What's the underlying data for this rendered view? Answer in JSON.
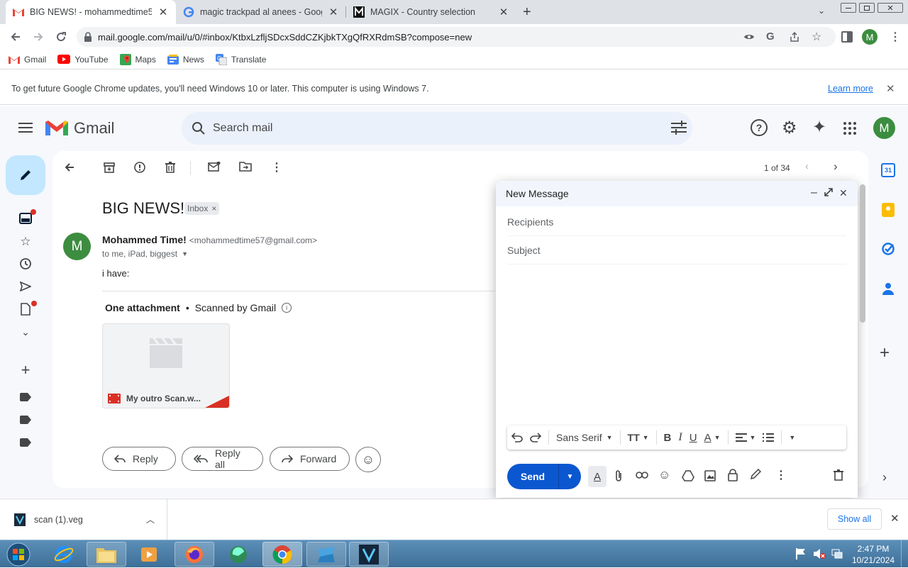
{
  "browser": {
    "tabs": [
      {
        "title": "BIG NEWS! - mohammedtime57@",
        "icon": "gmail-icon",
        "active": true
      },
      {
        "title": "magic trackpad al anees - Googl",
        "icon": "google-icon",
        "active": false
      },
      {
        "title": "MAGIX - Country selection",
        "icon": "magix-icon",
        "active": false
      }
    ],
    "url": "mail.google.com/mail/u/0/#inbox/KtbxLzfljSDcxSddCZKjbkTXgQfRXRdmSB?compose=new",
    "profile_initial": "M",
    "bookmarks": [
      {
        "label": "Gmail",
        "icon": "gmail-icon"
      },
      {
        "label": "YouTube",
        "icon": "youtube-icon"
      },
      {
        "label": "Maps",
        "icon": "maps-icon"
      },
      {
        "label": "News",
        "icon": "news-icon"
      },
      {
        "label": "Translate",
        "icon": "translate-icon"
      }
    ],
    "infobar": {
      "message": "To get future Google Chrome updates, you'll need Windows 10 or later. This computer is using Windows 7.",
      "link": "Learn more"
    }
  },
  "gmail": {
    "logo_text": "Gmail",
    "search_placeholder": "Search mail",
    "avatar_initial": "M",
    "pager": "1 of 34",
    "email": {
      "subject": "BIG NEWS!",
      "label_chip": "Inbox",
      "sender_name": "Mohammed Time!",
      "sender_email": "<mohammedtime57@gmail.com>",
      "recipients": "to me, iPad, biggest",
      "sender_initial": "M",
      "body": "i have:",
      "attachments_title": "One attachment",
      "scanned": "Scanned by Gmail",
      "attachment_name": "My outro Scan.w..."
    },
    "actions": {
      "reply": "Reply",
      "reply_all": "Reply all",
      "forward": "Forward"
    }
  },
  "compose": {
    "title": "New Message",
    "recipients_placeholder": "Recipients",
    "subject_placeholder": "Subject",
    "font": "Sans Serif",
    "send_label": "Send"
  },
  "downloads": {
    "file": "scan (1).veg",
    "show_all": "Show all"
  },
  "taskbar": {
    "time": "2:47 PM",
    "date": "10/21/2024"
  },
  "colors": {
    "gmail_red": "#ea4335",
    "send_blue": "#0b57d0",
    "avatar_green": "#3c8d3f"
  }
}
